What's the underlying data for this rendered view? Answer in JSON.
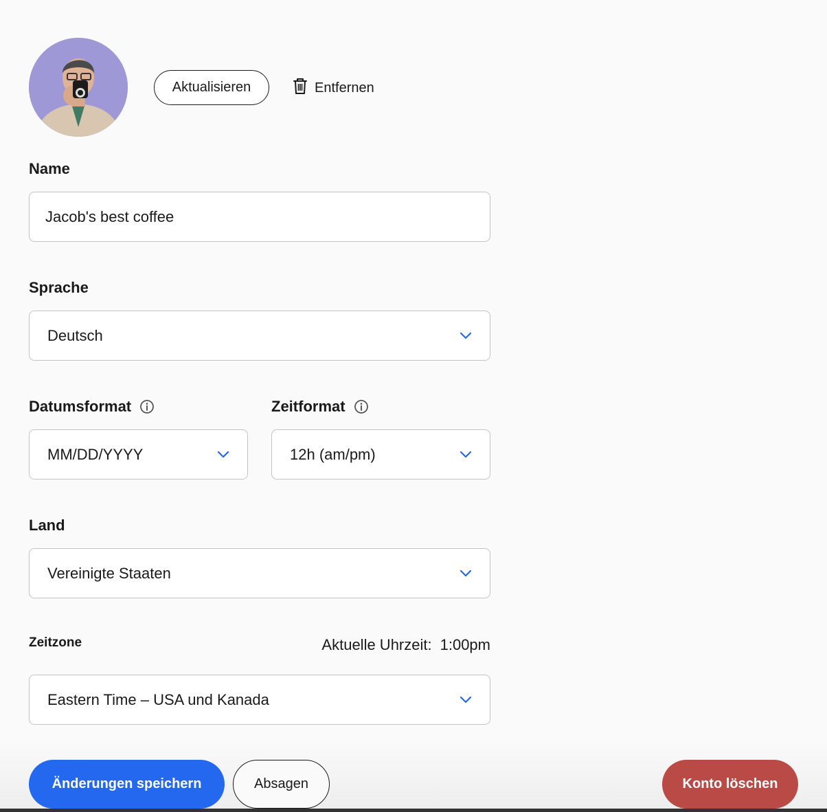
{
  "profile": {
    "update_label": "Aktualisieren",
    "remove_label": "Entfernen"
  },
  "form": {
    "name": {
      "label": "Name",
      "value": "Jacob's best coffee"
    },
    "language": {
      "label": "Sprache",
      "value": "Deutsch"
    },
    "date_format": {
      "label": "Datumsformat",
      "value": "MM/DD/YYYY"
    },
    "time_format": {
      "label": "Zeitformat",
      "value": "12h (am/pm)"
    },
    "country": {
      "label": "Land",
      "value": "Vereinigte Staaten"
    },
    "timezone": {
      "label": "Zeitzone",
      "current_time_label": "Aktuelle Uhrzeit:",
      "current_time_value": "1:00pm",
      "value": "Eastern Time – USA und Kanada"
    }
  },
  "actions": {
    "save_label": "Änderungen speichern",
    "cancel_label": "Absagen",
    "delete_label": "Konto löschen"
  },
  "colors": {
    "primary": "#2568f0",
    "danger": "#b94a45",
    "chevron": "#2568f0"
  }
}
